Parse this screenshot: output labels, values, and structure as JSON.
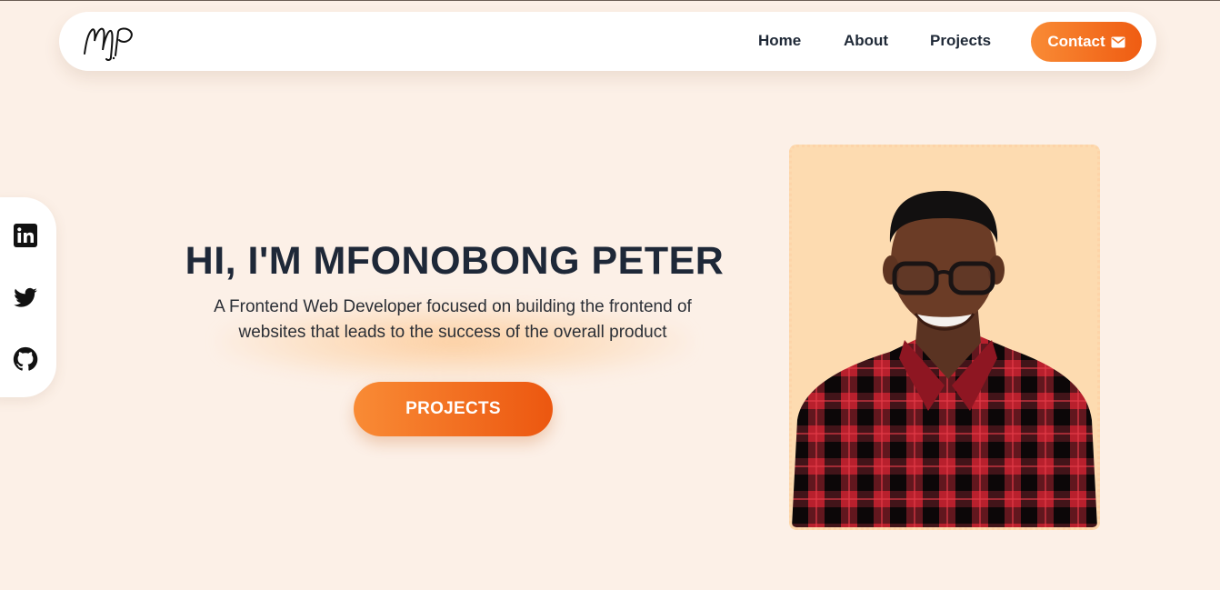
{
  "nav": {
    "logo_alt": "MP",
    "links": [
      {
        "label": "Home"
      },
      {
        "label": "About"
      },
      {
        "label": "Projects"
      }
    ],
    "contact_label": "Contact",
    "contact_icon": "envelope-icon"
  },
  "social": {
    "items": [
      {
        "icon": "linkedin-icon"
      },
      {
        "icon": "twitter-icon"
      },
      {
        "icon": "github-icon"
      }
    ]
  },
  "hero": {
    "title": "HI, I'M MFONOBONG PETER",
    "subtitle_line1": "A Frontend Web Developer focused on building the frontend of",
    "subtitle_line2": "websites that leads to the success of the overall product",
    "cta_label": "PROJECTS"
  },
  "portrait": {
    "icon": "profile-photo"
  },
  "colors": {
    "background": "#fcf0e7",
    "accent_start": "#f98b35",
    "accent_end": "#ef5c12",
    "portrait_bg": "#fddbb0",
    "text_dark": "#1e2838"
  }
}
